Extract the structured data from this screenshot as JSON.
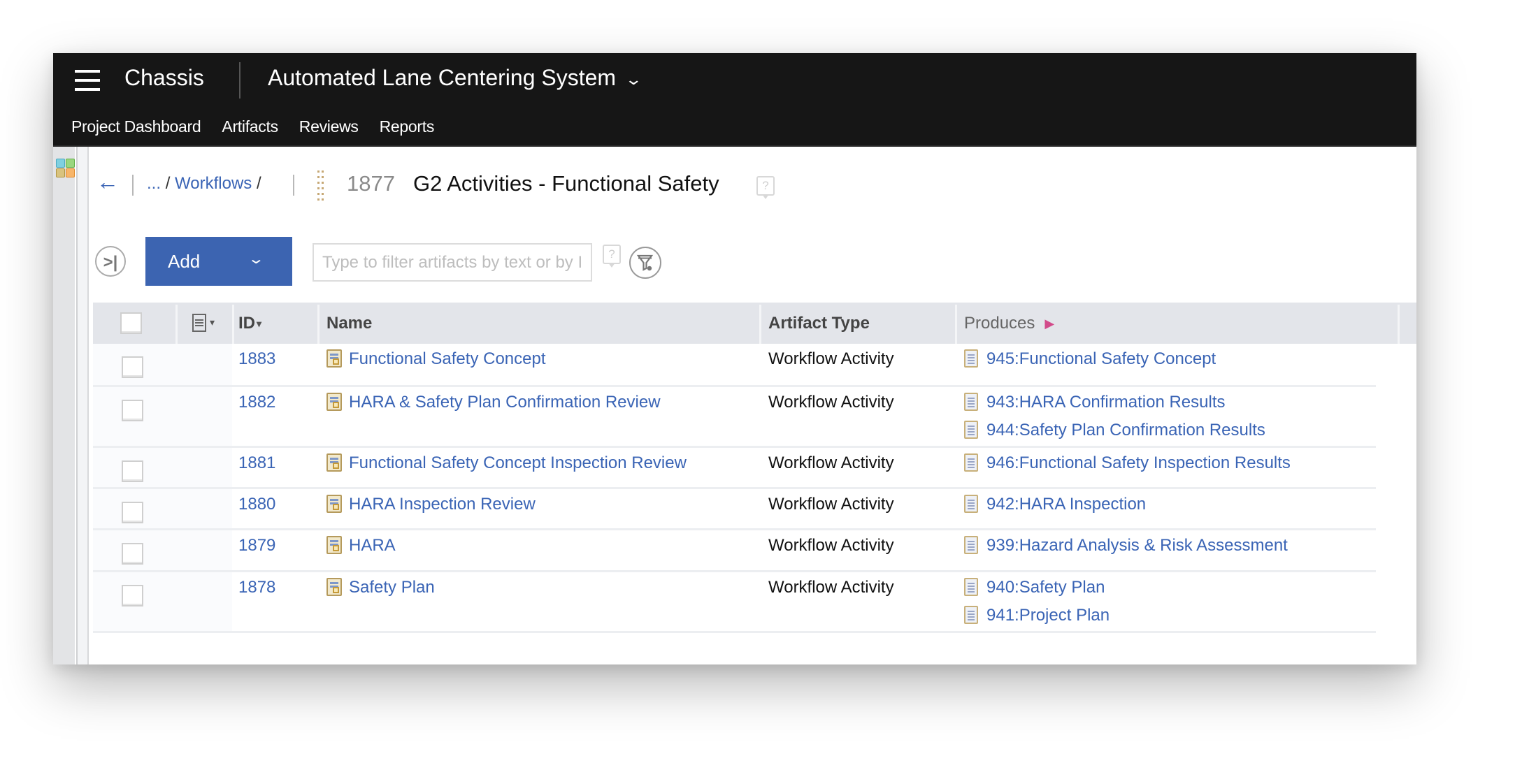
{
  "header": {
    "menu_icon": "hamburger-icon",
    "project": "Chassis",
    "system": "Automated Lane Centering System",
    "system_chevron": "⌄",
    "nav": [
      "Project Dashboard",
      "Artifacts",
      "Reviews",
      "Reports"
    ]
  },
  "breadcrumb": {
    "back_icon": "←",
    "ellipsis": "...",
    "slash": "/",
    "parent": "Workflows",
    "trailing_slash": "/"
  },
  "artifact": {
    "id": "1877",
    "title": "G2 Activities - Functional Safety",
    "help": "?"
  },
  "toolbar": {
    "collapse_icon": ">|",
    "add_label": "Add",
    "add_chevron": "⌄",
    "filter_placeholder": "Type to filter artifacts by text or by ID",
    "filter_value": "",
    "filter_help": "?"
  },
  "table": {
    "headers": {
      "id": "ID",
      "id_sort": "▾",
      "icon_col_caret": "▾",
      "name": "Name",
      "artifact_type": "Artifact Type",
      "produces": "Produces",
      "produces_arrow": "▶"
    },
    "colors": {
      "link": "#3a64b5",
      "produces_arrow": "#d24a8a",
      "add_button": "#3c64b1"
    },
    "rows": [
      {
        "id": "1883",
        "name": "Functional Safety Concept",
        "type": "Workflow Activity",
        "produces": [
          "945:Functional Safety Concept"
        ]
      },
      {
        "id": "1882",
        "name": "HARA & Safety Plan Confirmation Review",
        "type": "Workflow Activity",
        "produces": [
          "943:HARA Confirmation Results",
          "944:Safety Plan Confirmation Results"
        ]
      },
      {
        "id": "1881",
        "name": "Functional Safety Concept Inspection Review",
        "type": "Workflow Activity",
        "produces": [
          "946:Functional Safety Inspection Results"
        ]
      },
      {
        "id": "1880",
        "name": "HARA Inspection Review",
        "type": "Workflow Activity",
        "produces": [
          "942:HARA Inspection"
        ]
      },
      {
        "id": "1879",
        "name": "HARA",
        "type": "Workflow Activity",
        "produces": [
          "939:Hazard Analysis & Risk Assessment"
        ]
      },
      {
        "id": "1878",
        "name": "Safety Plan",
        "type": "Workflow Activity",
        "produces": [
          "940:Safety Plan",
          "941:Project Plan"
        ]
      }
    ]
  }
}
